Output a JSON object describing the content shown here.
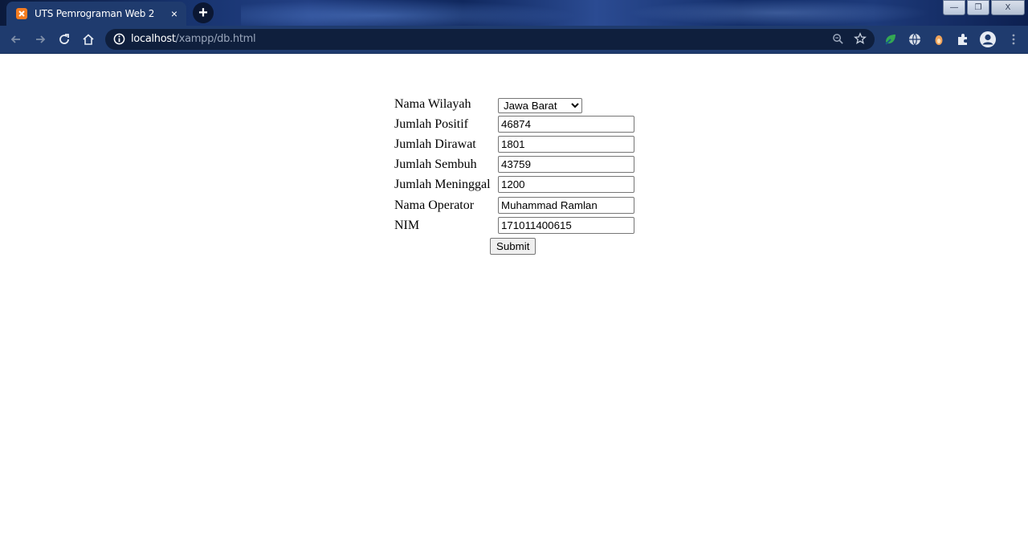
{
  "browser": {
    "tab_title": "UTS Pemrograman Web 2",
    "tab_close_label": "×",
    "new_tab_label": "+",
    "url_host": "localhost",
    "url_path": "/xampp/db.html",
    "window_controls": {
      "minimize": "—",
      "maximize": "❐",
      "close": "X"
    },
    "icons": [
      "xampp-favicon-icon",
      "back-icon",
      "forward-icon",
      "reload-icon",
      "home-icon",
      "info-icon",
      "zoom-icon",
      "star-icon",
      "extension-leaf-icon",
      "globe-icon",
      "extension-drop-icon",
      "puzzle-icon",
      "profile-icon",
      "menu-icon"
    ]
  },
  "form": {
    "fields": [
      {
        "label": "Nama Wilayah",
        "type": "select",
        "value": "Jawa Barat"
      },
      {
        "label": "Jumlah Positif",
        "type": "text",
        "value": "46874"
      },
      {
        "label": "Jumlah Dirawat",
        "type": "text",
        "value": "1801"
      },
      {
        "label": "Jumlah Sembuh",
        "type": "text",
        "value": "43759"
      },
      {
        "label": "Jumlah Meninggal",
        "type": "text",
        "value": "1200"
      },
      {
        "label": "Nama Operator",
        "type": "text",
        "value": "Muhammad Ramlan"
      },
      {
        "label": "NIM",
        "type": "text",
        "value": "171011400615"
      }
    ],
    "submit_label": "Submit"
  },
  "colors": {
    "chrome_toolbar": "#1f3b6e",
    "omnibox_bg": "#0f1f3d",
    "favicon": "#f57c20"
  }
}
